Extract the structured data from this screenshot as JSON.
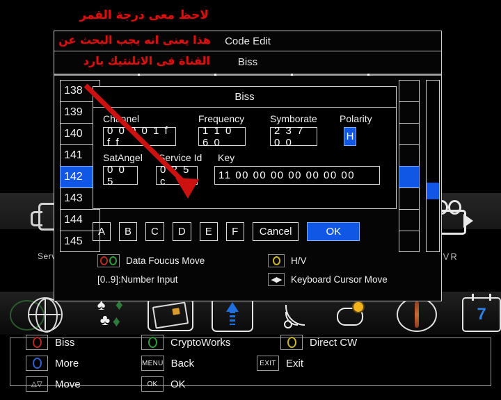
{
  "annotation": {
    "lines": [
      "لاحظ معى درجة القمر",
      "هذا يعنى انه يجب البحث عن",
      "القناة فى الاتلنتيك بارد"
    ],
    "color": "#d81010",
    "arrow_name": "red-pointer-arrow"
  },
  "panel": {
    "title": "Code Edit",
    "subtitle": "Biss"
  },
  "channel_list": {
    "items": [
      "138",
      "139",
      "140",
      "141",
      "142",
      "143",
      "144",
      "145"
    ],
    "selected": "142",
    "selected_index": 4
  },
  "dialog": {
    "title": "Biss",
    "fields": [
      {
        "label": "Channel",
        "value": "0 0 0 0 1 f f f",
        "name": "channel"
      },
      {
        "label": "Frequency",
        "value": "1 1 0 6 0",
        "name": "frequency"
      },
      {
        "label": "Symborate",
        "value": "2 3 7 0 0",
        "name": "symborate"
      },
      {
        "label": "Polarity",
        "value": "H",
        "name": "polarity",
        "highlight": true
      },
      {
        "label": "SatAngel",
        "value": "0 0 5",
        "name": "satangel"
      },
      {
        "label": "Service Id",
        "value": "0 2 5 c",
        "name": "service-id"
      },
      {
        "label": "Key",
        "value": "11 00 00 00 00 00 00 00",
        "name": "key"
      }
    ],
    "buttons": [
      {
        "label": "A",
        "name": "hex-a"
      },
      {
        "label": "B",
        "name": "hex-b"
      },
      {
        "label": "C",
        "name": "hex-c"
      },
      {
        "label": "D",
        "name": "hex-d"
      },
      {
        "label": "E",
        "name": "hex-e"
      },
      {
        "label": "F",
        "name": "hex-f"
      },
      {
        "label": "Cancel",
        "name": "cancel"
      },
      {
        "label": "OK",
        "name": "ok",
        "highlight": true
      }
    ],
    "hints": [
      {
        "label": "Data Foucus Move",
        "keys": "red-green-circles"
      },
      {
        "label": "H/V",
        "keys": "yellow-circle"
      },
      {
        "label": "[0..9]:Number Input",
        "keys": "number-keys"
      },
      {
        "label": "Keyboard Cursor Move",
        "keys": "left-right-arrows"
      }
    ]
  },
  "helpbar": {
    "items": [
      {
        "key": "",
        "icon": "red-circle",
        "label": "Biss",
        "name": "biss"
      },
      {
        "key": "",
        "icon": "green-circle",
        "label": "CryptoWorks",
        "name": "cryptoworks"
      },
      {
        "key": "",
        "icon": "yellow-circle",
        "label": "Direct CW",
        "name": "direct-cw"
      },
      {
        "key": "",
        "icon": "blue-circle",
        "label": "More",
        "name": "more"
      },
      {
        "key": "MENU",
        "icon": "",
        "label": "Back",
        "name": "back"
      },
      {
        "key": "EXIT",
        "icon": "",
        "label": "Exit",
        "name": "exit"
      },
      {
        "key": "△▽",
        "icon": "",
        "label": "Move",
        "name": "move"
      },
      {
        "key": "OK",
        "icon": "",
        "label": "OK",
        "name": "ok"
      }
    ]
  },
  "background": {
    "service_label": "Serv",
    "pvr_label": "PVR",
    "calendar_day": "7",
    "dock_icons": [
      "globe-icon",
      "card-suits-icon",
      "smartcard-icon",
      "upload-arrow-icon",
      "rss-signal-icon",
      "weather-icon",
      "compass-icon",
      "calendar-icon"
    ]
  }
}
